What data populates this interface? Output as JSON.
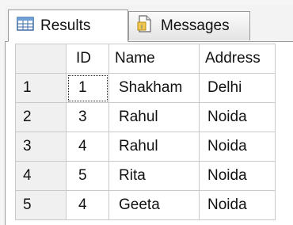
{
  "tabs": [
    {
      "label": "Results",
      "icon": "grid-icon",
      "active": true
    },
    {
      "label": "Messages",
      "icon": "document-icon",
      "active": false
    }
  ],
  "columns": [
    "ID",
    "Name",
    "Address"
  ],
  "rows": [
    {
      "num": "1",
      "id": "1",
      "name": "Shakham",
      "address": "Delhi"
    },
    {
      "num": "2",
      "id": "3",
      "name": "Rahul",
      "address": "Noida"
    },
    {
      "num": "3",
      "id": "4",
      "name": "Rahul",
      "address": "Noida"
    },
    {
      "num": "4",
      "id": "5",
      "name": "Rita",
      "address": "Noida"
    },
    {
      "num": "5",
      "id": "4",
      "name": "Geeta",
      "address": "Noida"
    }
  ],
  "colors": {
    "border": "#9a9a9a",
    "grid_line": "#c9c9c9",
    "header_bg": "#f0f0f0"
  }
}
